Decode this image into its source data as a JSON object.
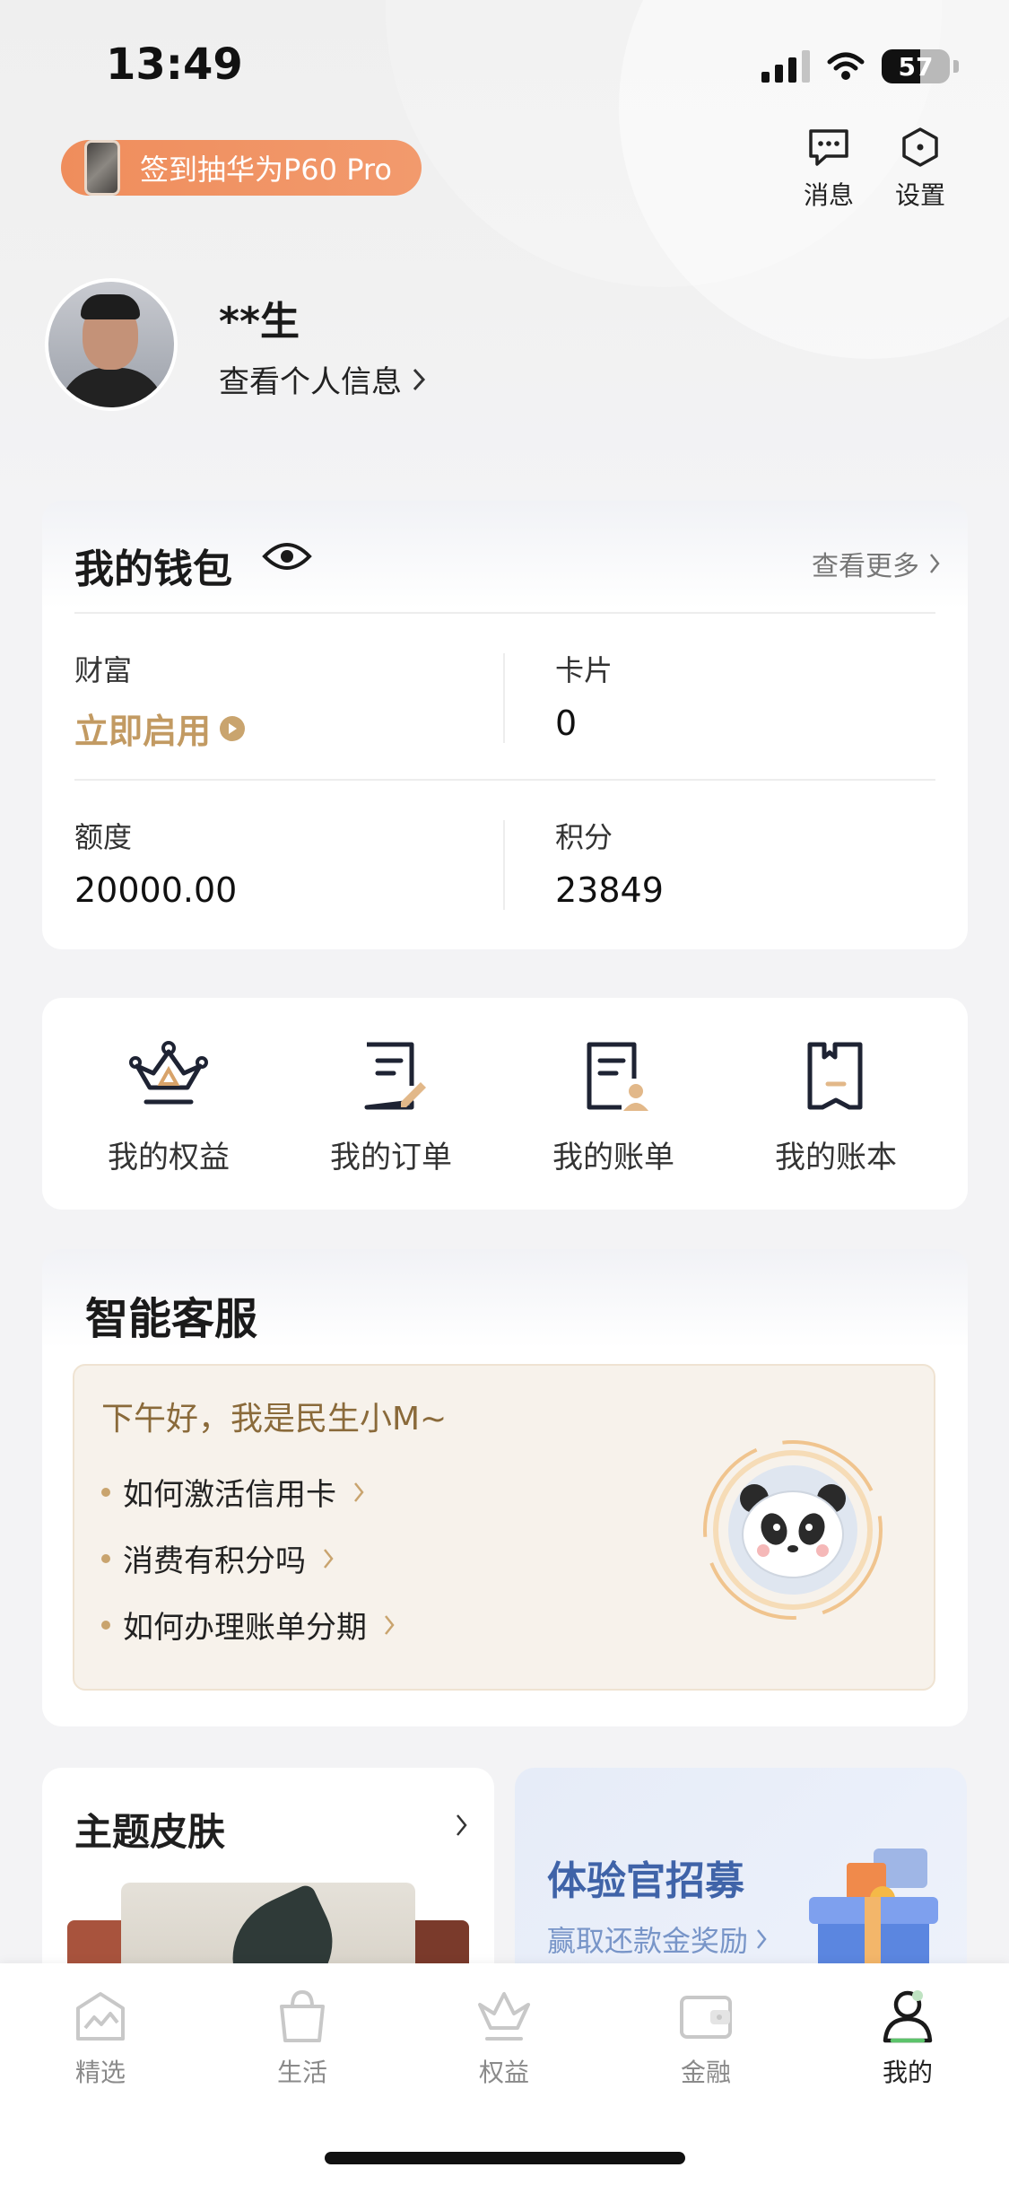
{
  "status_bar": {
    "time": "13:49",
    "battery": "57",
    "battery_fraction": 0.57
  },
  "promo": {
    "label": "签到抽华为P60 Pro"
  },
  "top_actions": [
    {
      "label": "消息",
      "icon": "message-icon"
    },
    {
      "label": "设置",
      "icon": "settings-icon"
    }
  ],
  "profile": {
    "name": "**生",
    "view_label": "查看个人信息"
  },
  "wallet": {
    "title": "我的钱包",
    "more": "查看更多",
    "items": [
      {
        "label": "财富",
        "value": "立即启用"
      },
      {
        "label": "卡片",
        "value": "0"
      },
      {
        "label": "额度",
        "value": "20000.00"
      },
      {
        "label": "积分",
        "value": "23849"
      }
    ],
    "accent": "#c29a62"
  },
  "shortcuts": [
    {
      "label": "我的权益",
      "icon": "crown-icon"
    },
    {
      "label": "我的订单",
      "icon": "order-icon"
    },
    {
      "label": "我的账单",
      "icon": "bill-icon"
    },
    {
      "label": "我的账本",
      "icon": "ledger-icon"
    }
  ],
  "customer_service": {
    "title": "智能客服",
    "greeting": "下午好，我是民生小M~",
    "questions": [
      "如何激活信用卡",
      "消费有积分吗",
      "如何办理账单分期"
    ]
  },
  "theme": {
    "title": "主题皮肤"
  },
  "recruit": {
    "title": "体验官招募",
    "subtitle": "赢取还款金奖励",
    "color": "#3f63a8"
  },
  "tabs": [
    {
      "label": "精选",
      "icon": "featured-icon"
    },
    {
      "label": "生活",
      "icon": "life-bag-icon"
    },
    {
      "label": "权益",
      "icon": "benefits-crown-icon"
    },
    {
      "label": "金融",
      "icon": "wallet-icon"
    },
    {
      "label": "我的",
      "icon": "profile-icon",
      "active": true
    }
  ]
}
